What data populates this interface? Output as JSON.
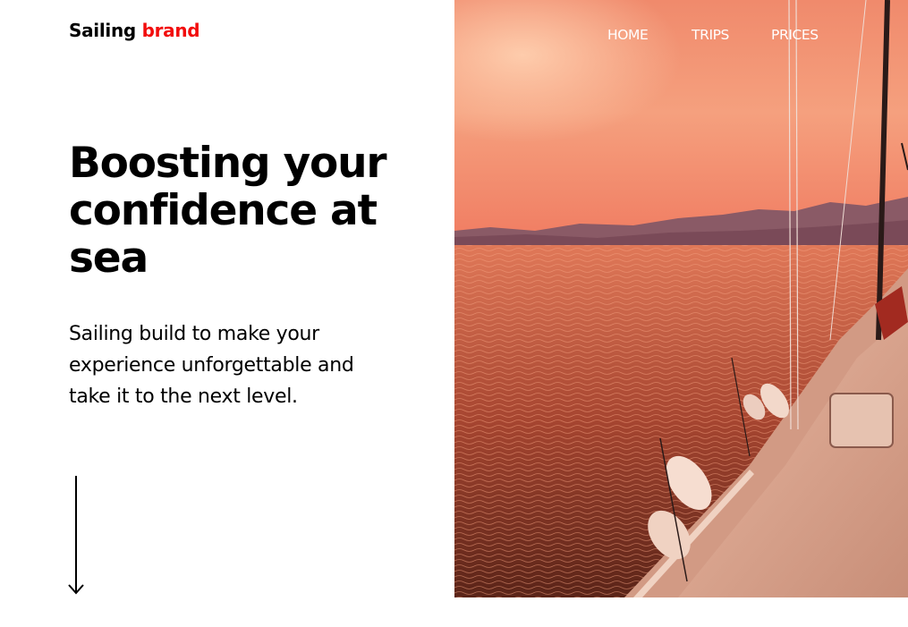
{
  "brand": {
    "name": "Sailing",
    "accent": "brand",
    "accent_color": "#f20d0d"
  },
  "nav": {
    "items": [
      "HOME",
      "TRIPS",
      "PRICES"
    ]
  },
  "hero": {
    "headline": "Boosting your confidence at sea",
    "subtitle": "Sailing build to make your experience unforgettable and take it to the next level."
  },
  "icons": {
    "scroll": "arrow-down-icon"
  }
}
